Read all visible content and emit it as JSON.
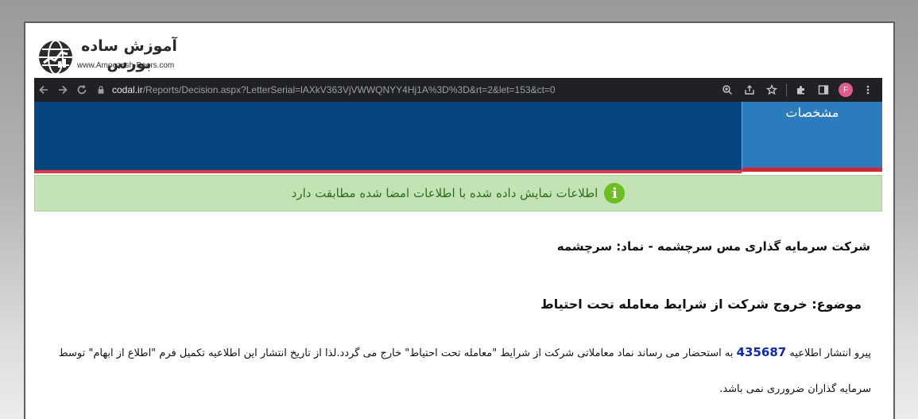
{
  "logo": {
    "fa_text": "آموزش ساده بورس",
    "en_text": "www.Amoozesh-Boors.com"
  },
  "browser": {
    "url_domain": "codal.ir",
    "url_path": "/Reports/Decision.aspx?LetterSerial=lAXkV363VjVWWQNYY4Hj1A%3D%3D&rt=2&let=153&ct=0",
    "profile_initial": "F"
  },
  "header": {
    "tab_label": "مشخصات"
  },
  "info_message": "اطلاعات نمایش داده شده با اطلاعات امضا شده مطابقت دارد",
  "content": {
    "company_line": "شرکت سرمایه گذاری مس سرچشمه - نماد: سرچشمه",
    "subject": "موضوع: خروج شرکت از شرایط معامله تحت احتیاط",
    "body_prefix": "پیرو انتشار اطلاعیه ",
    "notice_number": "435687",
    "body_rest": " به استحضار می رساند نماد معاملاتی شرکت از شرایط \"معامله تحت احتیاط\" خارج می گردد.لذا از تاریخ انتشار این اطلاعیه تکمیل فرم \"اطلاع از ابهام\" توسط سرمایه گذاران ضرورری نمی باشد."
  },
  "colors": {
    "banner": "#064680",
    "tab": "#2b7bbd",
    "accent_red": "#e0393e",
    "info_bg": "#c3e3b4",
    "info_text": "#2f6d1e",
    "number": "#0c2ab8"
  }
}
